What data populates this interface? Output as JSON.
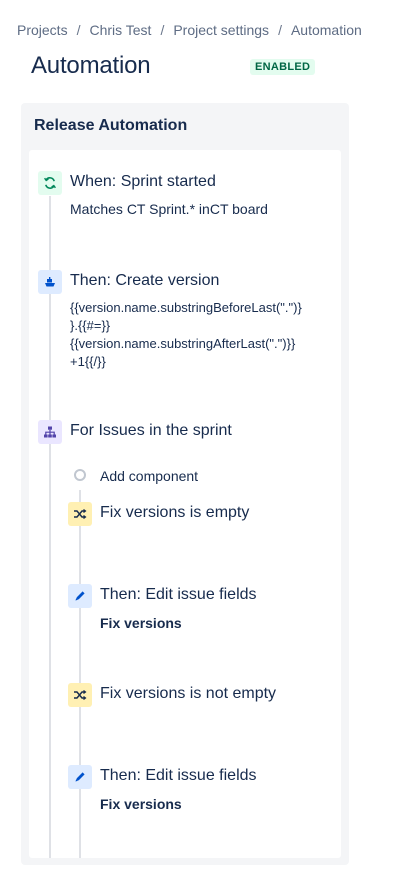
{
  "breadcrumb": {
    "items": [
      "Projects",
      "Chris Test",
      "Project settings",
      "Automation"
    ],
    "separator": "/"
  },
  "page": {
    "title": "Automation",
    "status": "ENABLED"
  },
  "rule": {
    "name": "Release Automation",
    "trigger": {
      "title": "When: Sprint started",
      "detail_prefix": "Matches",
      "detail_sprint": "CT Sprint.*",
      "detail_in": "in",
      "detail_board": "CT board",
      "icon": "refresh-icon"
    },
    "action_create_version": {
      "title": "Then: Create version",
      "lines": [
        "{{version.name.substringBeforeLast(\".\")}",
        "}.{{#=}}",
        "{{version.name.substringAfterLast(\".\")}}",
        "+1{{/}}"
      ],
      "icon": "ship-icon"
    },
    "branch": {
      "title": "For Issues in the sprint",
      "add_component": "Add component",
      "icon": "hierarchy-icon",
      "steps": [
        {
          "kind": "condition",
          "title": "Fix versions is empty",
          "icon": "shuffle-icon"
        },
        {
          "kind": "action",
          "title": "Then: Edit issue fields",
          "detail": "Fix versions",
          "icon": "pencil-icon"
        },
        {
          "kind": "condition",
          "title": "Fix versions is not empty",
          "icon": "shuffle-icon"
        },
        {
          "kind": "action",
          "title": "Then: Edit issue fields",
          "detail": "Fix versions",
          "icon": "pencil-icon"
        }
      ]
    }
  },
  "colors": {
    "trigger_bg": "#e3fcef",
    "trigger_fg": "#00875a",
    "action_bg": "#deebff",
    "action_fg": "#0052cc",
    "branch_bg": "#eae6ff",
    "branch_fg": "#5243aa",
    "condition_bg": "#fff0b3",
    "condition_fg": "#172b4d",
    "badge_bg": "#e3fcef",
    "badge_fg": "#006644"
  }
}
